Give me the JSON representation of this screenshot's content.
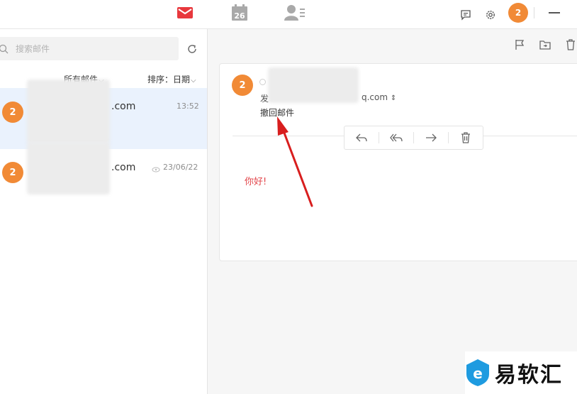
{
  "topbar": {
    "calendar_day": "26",
    "notification_count": "2"
  },
  "search": {
    "placeholder": "搜索邮件"
  },
  "filter": {
    "all_label": "所有邮件",
    "sort_label": "排序：日期"
  },
  "mail_list": [
    {
      "avatar": "2",
      "sender_suffix": ".com",
      "time": "13:52",
      "selected": true
    },
    {
      "avatar": "2",
      "sender_suffix": ".com",
      "time": "23/06/22",
      "selected": false
    }
  ],
  "message": {
    "avatar": "2",
    "sender_prefix": "发",
    "sender_domain": "q.com",
    "recall_label": "撤回邮件",
    "body": "你好!"
  },
  "watermark": {
    "text": "易软汇"
  },
  "colors": {
    "accent_orange": "#f18a36",
    "mail_red": "#e8383d",
    "arrow_red": "#d81e1e",
    "selected_bg": "#eaf2fd"
  }
}
